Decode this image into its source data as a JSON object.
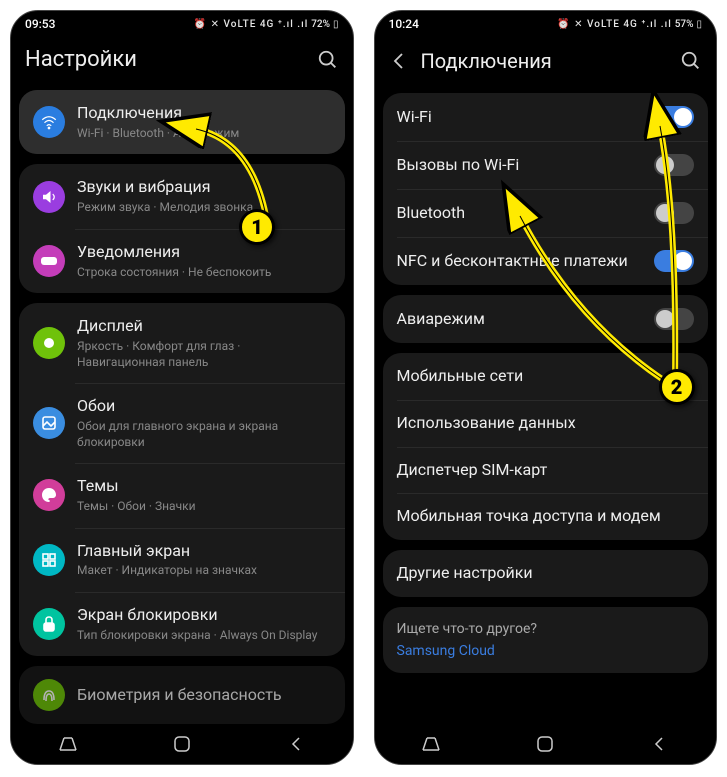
{
  "left": {
    "status": {
      "time": "09:53",
      "icons": "⏰ ✕ VoLTE 4G ⁺.ıl .ıl",
      "battery": "72%",
      "batt_icon": "▯"
    },
    "title": "Настройки",
    "groups": [
      {
        "rows": [
          {
            "icon": "wifi",
            "color": "#2a7de0",
            "title": "Подключения",
            "sub": "Wi-Fi · Bluetooth · Авиарежим",
            "highlighted": true
          }
        ]
      },
      {
        "rows": [
          {
            "icon": "sound",
            "color": "#9a3de0",
            "title": "Звуки и вибрация",
            "sub": "Режим звука · Мелодия звонка"
          },
          {
            "icon": "notif",
            "color": "#c43db9",
            "title": "Уведомления",
            "sub": "Строка состояния · Не беспокоить"
          }
        ]
      },
      {
        "rows": [
          {
            "icon": "display",
            "color": "#6fc20a",
            "title": "Дисплей",
            "sub": "Яркость · Комфорт для глаз · Навигационная панель"
          },
          {
            "icon": "wallpaper",
            "color": "#3a8de0",
            "title": "Обои",
            "sub": "Обои для главного экрана и экрана блокировки"
          },
          {
            "icon": "themes",
            "color": "#d13d9a",
            "title": "Темы",
            "sub": "Темы · Обои · Значки"
          },
          {
            "icon": "home",
            "color": "#00b8c4",
            "title": "Главный экран",
            "sub": "Макет · Индикаторы на значках"
          },
          {
            "icon": "lock",
            "color": "#00c4a0",
            "title": "Экран блокировки",
            "sub": "Тип блокировки экрана · Always On Display"
          }
        ]
      },
      {
        "rows": [
          {
            "icon": "biometry",
            "color": "#6fc20a",
            "title": "Биометрия и безопасность",
            "sub": ""
          }
        ]
      }
    ],
    "annotation": {
      "marker": "1"
    }
  },
  "right": {
    "status": {
      "time": "10:24",
      "icons": "⏰ ✕ VoLTE 4G ⁺.ıl .ıl",
      "battery": "57%",
      "batt_icon": "▯"
    },
    "title": "Подключения",
    "groups": [
      {
        "rows": [
          {
            "title": "Wi-Fi",
            "toggle": "on"
          },
          {
            "title": "Вызовы по Wi-Fi",
            "toggle": "off"
          },
          {
            "title": "Bluetooth",
            "toggle": "off"
          },
          {
            "title": "NFC и бесконтактные платежи",
            "toggle": "on"
          }
        ]
      },
      {
        "rows": [
          {
            "title": "Авиарежим",
            "toggle": "off"
          }
        ]
      },
      {
        "rows": [
          {
            "title": "Мобильные сети"
          },
          {
            "title": "Использование данных"
          },
          {
            "title": "Диспетчер SIM-карт"
          },
          {
            "title": "Мобильная точка доступа и модем"
          }
        ]
      },
      {
        "rows": [
          {
            "title": "Другие настройки"
          }
        ]
      }
    ],
    "looking": {
      "question": "Ищете что-то другое?",
      "link": "Samsung Cloud"
    },
    "annotation": {
      "marker": "2"
    }
  }
}
